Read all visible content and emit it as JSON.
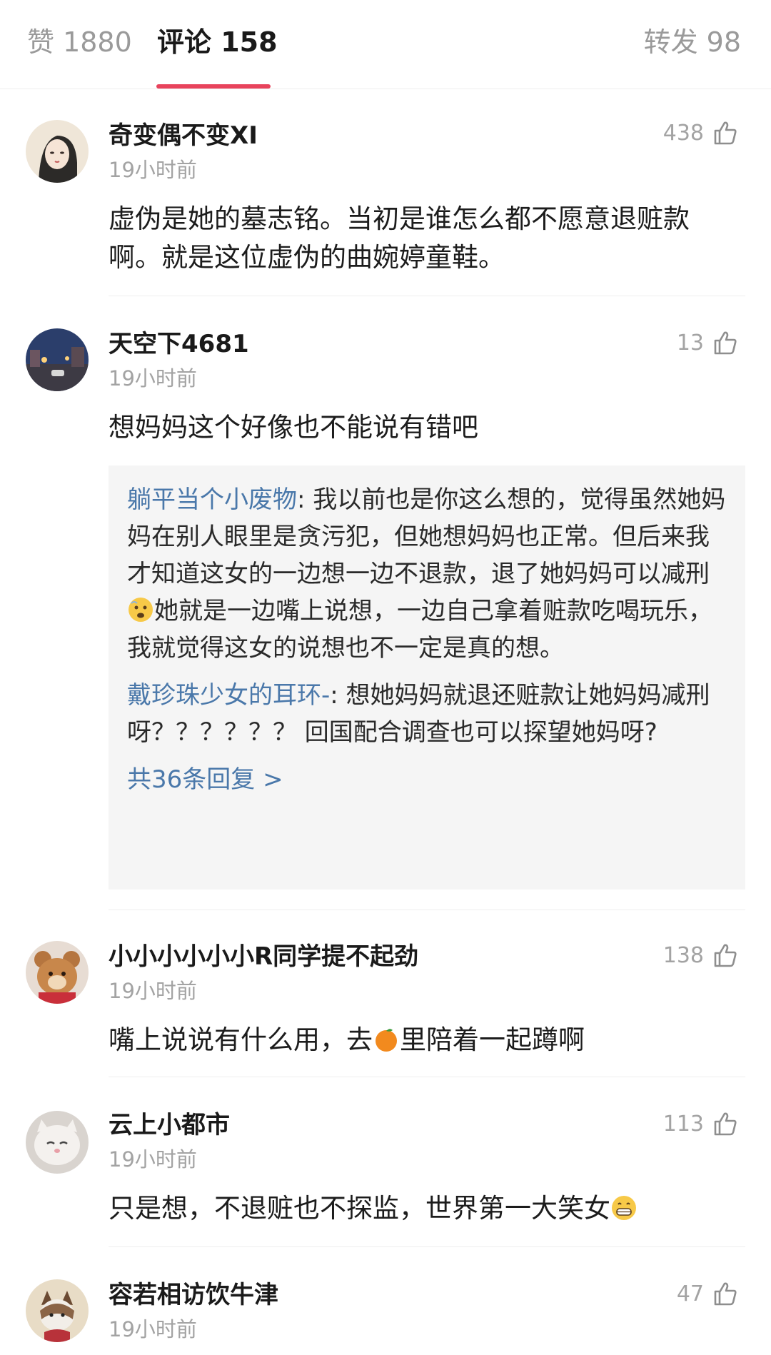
{
  "tabs": {
    "likes": "赞 1880",
    "comments": "评论 158",
    "reposts": "转发 98"
  },
  "comments": [
    {
      "name": "奇变偶不变XI",
      "time": "19小时前",
      "likes": "438",
      "text": "虚伪是她的墓志铭。当初是谁怎么都不愿意退赃款啊。就是这位虚伪的曲婉婷童鞋。"
    },
    {
      "name": "天空下4681",
      "time": "19小时前",
      "likes": "13",
      "text": "想妈妈这个好像也不能说有错吧",
      "replies": [
        {
          "name": "躺平当个小废物",
          "text_before_emoji": ": 我以前也是你这么想的，觉得虽然她妈妈在别人眼里是贪污犯，但她想妈妈也正常。但后来我才知道这女的一边想一边不退款，退了她妈妈可以减刑",
          "text_after_emoji": "她就是一边嘴上说想，一边自己拿着赃款吃喝玩乐，我就觉得这女的说想也不一定是真的想。"
        },
        {
          "name": "戴珍珠少女的耳环-",
          "text": ": 想她妈妈就退还赃款让她妈妈减刑呀？？？？？？ 回国配合调查也可以探望她妈呀?"
        }
      ],
      "more_replies": "共36条回复 >"
    },
    {
      "name": "小小小小小小R同学提不起劲",
      "time": "19小时前",
      "likes": "138",
      "text_before_emoji": "嘴上说说有什么用，去",
      "text_after_emoji": "里陪着一起蹲啊"
    },
    {
      "name": "云上小都市",
      "time": "19小时前",
      "likes": "113",
      "text": "只是想，不退赃也不探监，世界第一大笑女"
    },
    {
      "name": "容若相访饮牛津",
      "time": "19小时前",
      "likes": "47"
    }
  ],
  "colors": {
    "accent_underline": "#e8435c",
    "reply_name": "#4a78aa",
    "muted": "#a3a3a3"
  }
}
